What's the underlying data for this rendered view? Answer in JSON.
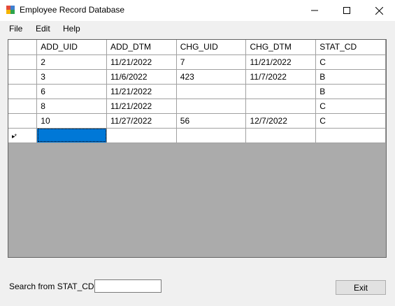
{
  "window": {
    "title": "Employee Record Database"
  },
  "menu": {
    "items": [
      "File",
      "Edit",
      "Help"
    ]
  },
  "grid": {
    "columns": [
      "ADD_UID",
      "ADD_DTM",
      "CHG_UID",
      "CHG_DTM",
      "STAT_CD"
    ],
    "rows": [
      [
        "2",
        "11/21/2022",
        "7",
        "11/21/2022",
        "C"
      ],
      [
        "3",
        "11/6/2022",
        "423",
        "11/7/2022",
        "B"
      ],
      [
        "6",
        "11/21/2022",
        "",
        "",
        "B"
      ],
      [
        "8",
        "11/21/2022",
        "",
        "",
        "C"
      ],
      [
        "10",
        "11/27/2022",
        "56",
        "12/7/2022",
        "C"
      ]
    ],
    "new_row_marker": "▸*"
  },
  "search": {
    "label": "Search from STAT_CD:",
    "value": ""
  },
  "buttons": {
    "exit": "Exit"
  },
  "colors": {
    "selection": "#0078d7",
    "grid_background": "#ababab",
    "window_background": "#f0f0f0"
  }
}
